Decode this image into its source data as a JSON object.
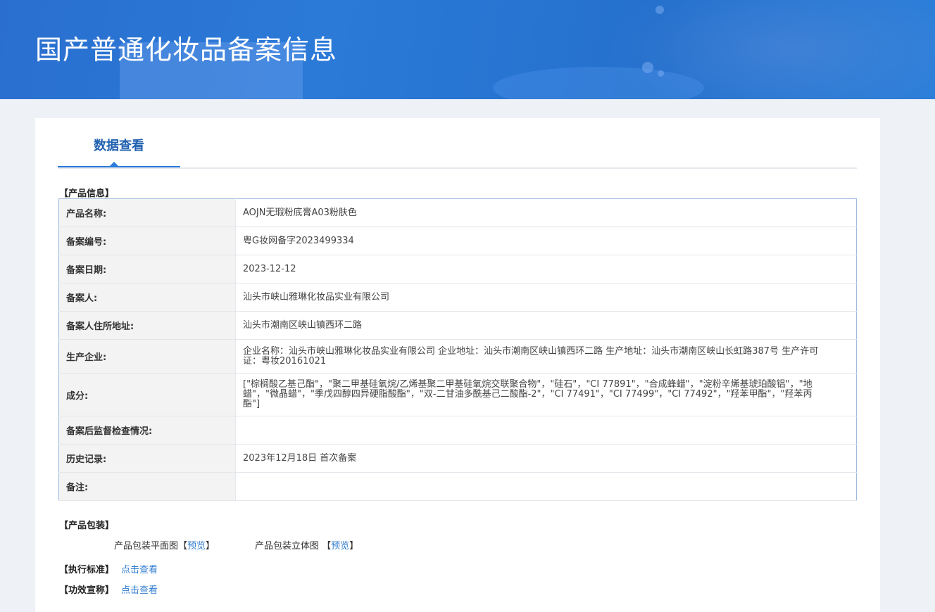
{
  "header": {
    "title": "国产普通化妆品备案信息"
  },
  "tabs": [
    {
      "label": "数据查看"
    }
  ],
  "product_info": {
    "section_title": "【产品信息】",
    "rows": [
      {
        "label": "产品名称:",
        "value": "AOJN无瑕粉底膏A03粉肤色"
      },
      {
        "label": "备案编号:",
        "value": "粤G妆网备字2023499334"
      },
      {
        "label": "备案日期:",
        "value": "2023-12-12"
      },
      {
        "label": "备案人:",
        "value": "汕头市峡山雅琳化妆品实业有限公司"
      },
      {
        "label": "备案人住所地址:",
        "value": "汕头市潮南区峡山镇西环二路"
      },
      {
        "label": "生产企业:",
        "value": "企业名称：汕头市峡山雅琳化妆品实业有限公司 企业地址：汕头市潮南区峡山镇西环二路 生产地址：汕头市潮南区峡山长虹路387号 生产许可证：粤妆20161021"
      },
      {
        "label": "成分:",
        "value": "[\"棕榈酸乙基己酯\"，\"聚二甲基硅氧烷/乙烯基聚二甲基硅氧烷交联聚合物\"，\"硅石\"，\"CI 77891\"，\"合成蜂蜡\"，\"淀粉辛烯基琥珀酸铝\"，\"地蜡\"，\"微晶蜡\"，\"季戊四醇四异硬脂酸酯\"，\"双-二甘油多酰基己二酸酯-2\"，\"CI 77491\"，\"CI 77499\"，\"CI 77492\"，\"羟苯甲酯\"，\"羟苯丙酯\"]"
      },
      {
        "label": "备案后监督检查情况:",
        "value": ""
      },
      {
        "label": "历史记录:",
        "value": "2023年12月18日 首次备案"
      },
      {
        "label": "备注:",
        "value": ""
      }
    ]
  },
  "packaging": {
    "section_title": "【产品包装】",
    "flat_label": "产品包装平面图",
    "stereo_label": "产品包装立体图",
    "bracket_open": "【",
    "bracket_close": "】",
    "preview_label": "预览"
  },
  "standard": {
    "label": "【执行标准】",
    "link": "点击查看"
  },
  "efficacy": {
    "label": "【功效宣称】",
    "link": "点击查看"
  }
}
